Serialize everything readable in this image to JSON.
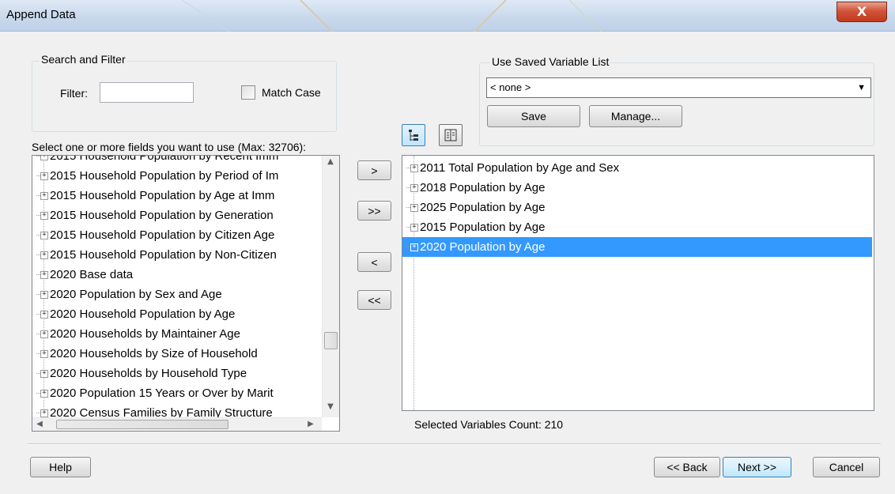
{
  "window": {
    "title": "Append Data",
    "close_label": "X"
  },
  "search_filter": {
    "legend": "Search and Filter",
    "filter_label": "Filter:",
    "filter_value": "",
    "match_case_label": "Match Case",
    "match_case_checked": false
  },
  "left_list": {
    "caption": "Select one or more fields you want to use (Max: 32706):",
    "items": [
      "2015 Household Population by Recent Imm",
      "2015 Household Population by Period of Im",
      "2015 Household Population by Age at Imm",
      "2015 Household Population by Generation",
      "2015 Household Population by Citizen Age",
      "2015 Household Population by Non-Citizen",
      "2020 Base data",
      "2020 Population by Sex and Age",
      "2020 Household Population by Age",
      "2020 Households by Maintainer Age",
      "2020 Households by Size of Household",
      "2020 Households by Household Type",
      "2020 Population 15 Years or Over by Marit",
      "2020 Census Families by Family Structure"
    ]
  },
  "transfer_buttons": {
    "add": ">",
    "add_all": ">>",
    "remove": "<",
    "remove_all": "<<"
  },
  "saved_list": {
    "legend": "Use Saved Variable List",
    "selected": "< none >",
    "save_label": "Save",
    "manage_label": "Manage..."
  },
  "view_icons": {
    "tree_view": "tree-view-icon",
    "list_view": "list-view-icon"
  },
  "right_list": {
    "items": [
      "2011 Total Population by Age and Sex",
      "2018 Population by Age",
      "2025 Population by Age",
      "2015 Population by Age",
      "2020 Population by Age"
    ],
    "selected_index": 4,
    "count_text": "Selected Variables Count: 210"
  },
  "footer": {
    "help_label": "Help",
    "back_label": "<< Back",
    "next_label": "Next >>",
    "cancel_label": "Cancel"
  },
  "colors": {
    "selection": "#3399ff",
    "close_button": "#c2391f"
  }
}
